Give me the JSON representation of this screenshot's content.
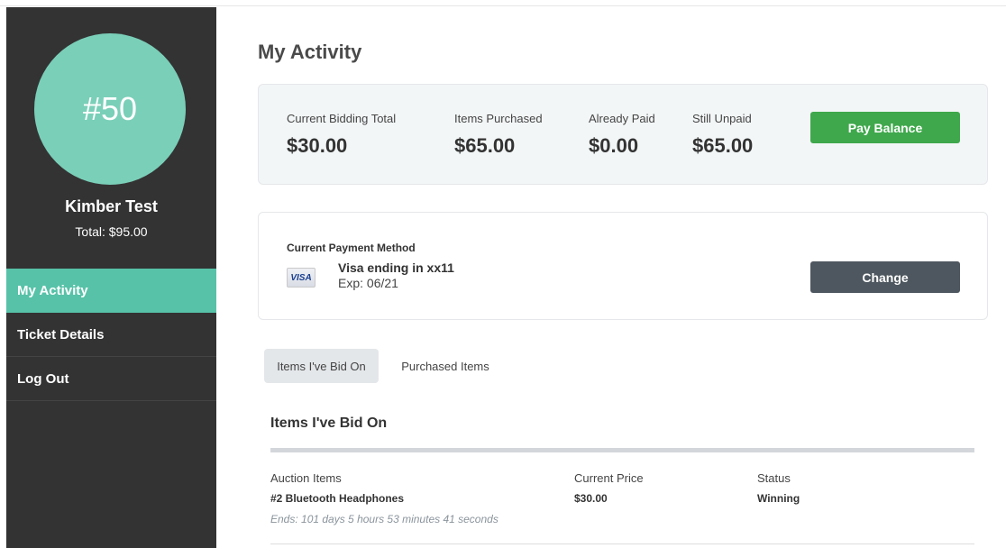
{
  "sidebar": {
    "avatar_number": "#50",
    "name": "Kimber Test",
    "total": "Total: $95.00",
    "nav": [
      {
        "label": "My Activity",
        "active": true
      },
      {
        "label": "Ticket Details",
        "active": false
      },
      {
        "label": "Log Out",
        "active": false
      }
    ]
  },
  "main": {
    "title": "My Activity",
    "summary": {
      "stats": [
        {
          "label": "Current Bidding Total",
          "value": "$30.00"
        },
        {
          "label": "Items Purchased",
          "value": "$65.00"
        },
        {
          "label": "Already Paid",
          "value": "$0.00"
        },
        {
          "label": "Still Unpaid",
          "value": "$65.00"
        }
      ],
      "pay_button": "Pay Balance"
    },
    "payment": {
      "heading": "Current Payment Method",
      "card_brand": "VISA",
      "card_name": "Visa ending in xx11",
      "expiry": "Exp: 06/21",
      "change_button": "Change"
    },
    "tabs": [
      {
        "label": "Items I've Bid On",
        "active": true
      },
      {
        "label": "Purchased Items",
        "active": false
      }
    ],
    "bids": {
      "section_title": "Items I've Bid On",
      "columns": [
        "Auction Items",
        "Current Price",
        "Status"
      ],
      "rows": [
        {
          "item": "#2 Bluetooth Headphones",
          "price": "$30.00",
          "status": "Winning",
          "ends": "Ends: 101 days 5 hours 53 minutes 41 seconds"
        }
      ]
    }
  },
  "colors": {
    "sidebar_bg": "#333333",
    "accent": "#57c2a8",
    "avatar": "#7acfb8",
    "pay_button": "#3fa84c",
    "change_button": "#4e575f"
  },
  "icons": {
    "card": "visa-card-icon"
  }
}
